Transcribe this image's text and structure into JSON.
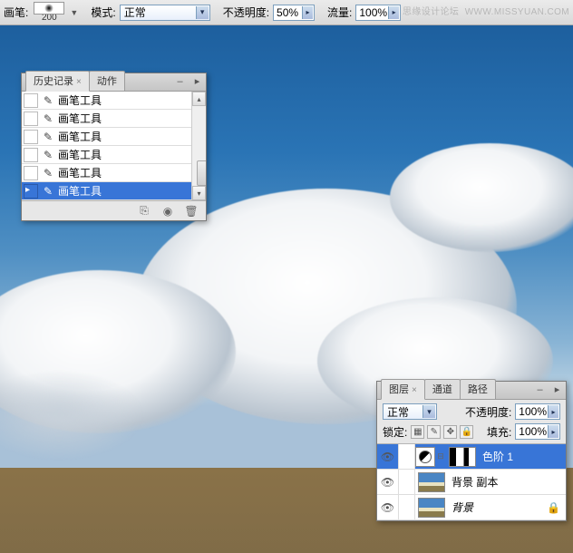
{
  "options_bar": {
    "brush_label": "画笔:",
    "brush_size": "200",
    "mode_label": "模式:",
    "mode_value": "正常",
    "opacity_label": "不透明度:",
    "opacity_value": "50%",
    "flow_label": "流量:",
    "flow_value": "100%"
  },
  "watermark": {
    "text1": "思缘设计论坛",
    "text2": "WWW.MISSYUAN.COM"
  },
  "history_panel": {
    "tab_history": "历史记录",
    "tab_actions": "动作",
    "items": [
      {
        "label": "画笔工具"
      },
      {
        "label": "画笔工具"
      },
      {
        "label": "画笔工具"
      },
      {
        "label": "画笔工具"
      },
      {
        "label": "画笔工具"
      },
      {
        "label": "画笔工具"
      }
    ]
  },
  "layers_panel": {
    "tab_layers": "图层",
    "tab_channels": "通道",
    "tab_paths": "路径",
    "blend_value": "正常",
    "opacity_label": "不透明度:",
    "opacity_value": "100%",
    "lock_label": "锁定:",
    "fill_label": "填充:",
    "fill_value": "100%",
    "layers": [
      {
        "name": "色阶 1",
        "selected": true,
        "type": "adjustment"
      },
      {
        "name": "背景 副本",
        "selected": false,
        "type": "image"
      },
      {
        "name": "背景",
        "selected": false,
        "type": "image",
        "italic": true
      }
    ]
  }
}
